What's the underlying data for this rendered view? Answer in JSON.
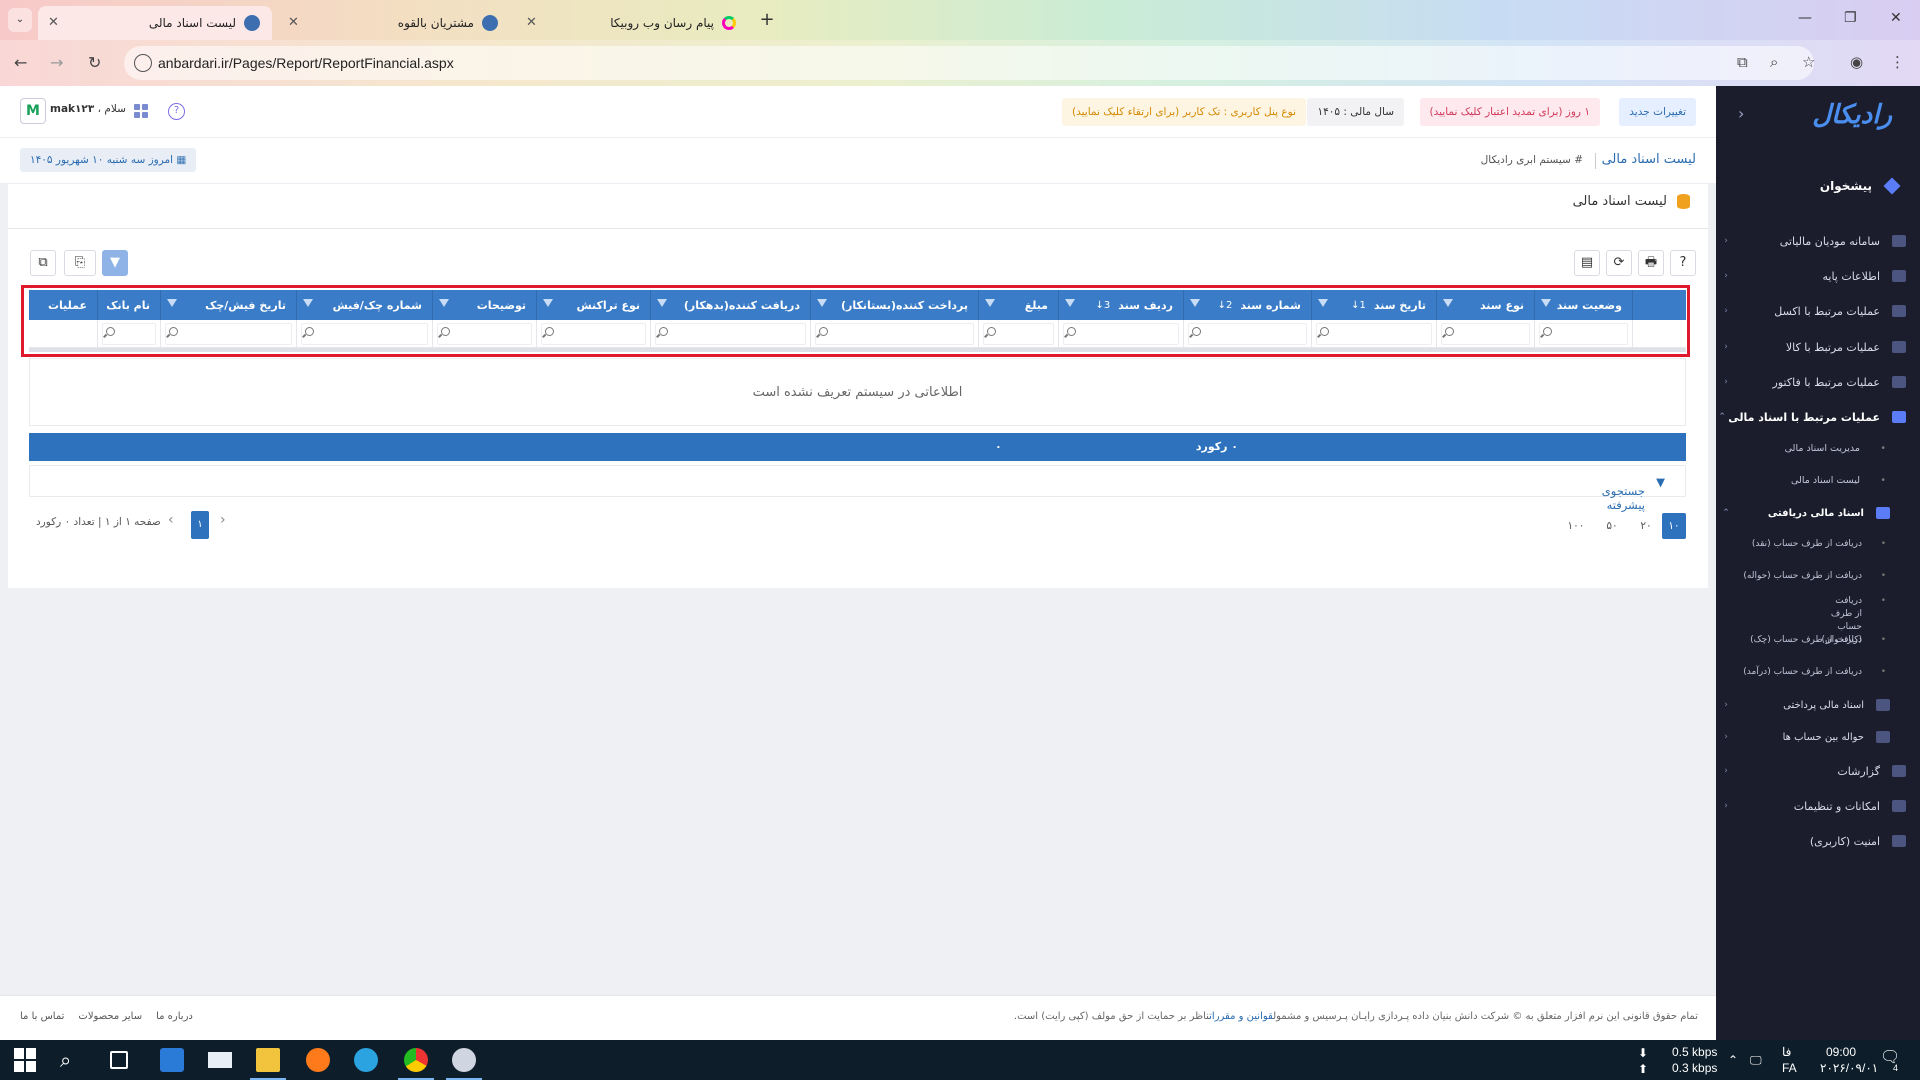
{
  "browser": {
    "tabs": [
      {
        "title": "لیست اسناد مالی",
        "active": true
      },
      {
        "title": "مشتریان بالقوه",
        "active": false
      },
      {
        "title": "پیام رسان وب روبیکا",
        "active": false
      }
    ],
    "new_tab": "+",
    "url": "anbardari.ir/Pages/Report/ReportFinancial.aspx"
  },
  "header": {
    "new_changes": "تغییرات جدید",
    "renew": "۱ روز (برای تمدید اعتبار کلیک نمایید)",
    "fiscal_year": "سال مالی : ۱۴۰۵",
    "panel_type": "نوع پنل کاربری : تک کاربر (برای ارتقاء کلیک نمایید)",
    "greeting_prefix": "سلام ،",
    "username": "mak۱۲۳",
    "avatar_letter": "M"
  },
  "breadcrumb": {
    "title": "لیست اسناد مالی",
    "system": "# سیستم ابری رادیکال",
    "today": "امروز سه شنبه ۱۰ شهریور ۱۴۰۵"
  },
  "panel": {
    "title": "لیست اسناد مالی",
    "toolbar": {
      "help": "?",
      "print": "🖶",
      "refresh": "⟳",
      "columns": "▤",
      "filter": "▼",
      "export": "⎘",
      "copy": "⧉"
    }
  },
  "grid": {
    "columns": [
      {
        "label": "",
        "sort": ""
      },
      {
        "label": "وضعیت سند",
        "sort": ""
      },
      {
        "label": "نوع سند",
        "sort": ""
      },
      {
        "label": "تاریخ سند",
        "sort": "1↓"
      },
      {
        "label": "شماره سند",
        "sort": "2↓"
      },
      {
        "label": "ردیف سند",
        "sort": "3↓"
      },
      {
        "label": "مبلغ",
        "sort": ""
      },
      {
        "label": "پرداخت کننده(بستانکار)",
        "sort": ""
      },
      {
        "label": "دریافت کننده(بدهکار)",
        "sort": ""
      },
      {
        "label": "نوع تراکنش",
        "sort": ""
      },
      {
        "label": "توضیحات",
        "sort": ""
      },
      {
        "label": "شماره چک/فیش",
        "sort": ""
      },
      {
        "label": "تاریخ فیش/چک",
        "sort": ""
      },
      {
        "label": "نام بانک",
        "sort": ""
      },
      {
        "label": "عملیات",
        "sort": ""
      }
    ],
    "empty_message": "اطلاعاتی در سیستم تعریف نشده است",
    "record_count": "۰ رکورد",
    "sum": "۰",
    "advanced_search": "جستجوی پیشرفته",
    "page_info": "صفحه ۱ از ۱ | تعداد ۰ رکورد",
    "current_page": "۱",
    "page_sizes": [
      "۱۰",
      "۲۰",
      "۵۰",
      "۱۰۰"
    ]
  },
  "sidebar": {
    "logo": "رادیکال",
    "dashboard": "پیشخوان",
    "items": [
      {
        "label": "سامانه مودیان مالیاتی",
        "arrow": "‹"
      },
      {
        "label": "اطلاعات پایه",
        "arrow": "‹"
      },
      {
        "label": "عملیات مرتبط با اکسل",
        "arrow": "‹"
      },
      {
        "label": "عملیات مرتبط با کالا",
        "arrow": "‹"
      },
      {
        "label": "عملیات مرتبط با فاکتور",
        "arrow": "‹"
      },
      {
        "label": "عملیات مرتبط با اسناد مالی",
        "arrow": "⌃"
      }
    ],
    "financial_subs": [
      "مدیریت اسناد مالی",
      "لیست اسناد مالی"
    ],
    "received": "اسناد مالی دریافتی",
    "received_subs": [
      "دریافت از طرف حساب (نقد)",
      "دریافت از طرف حساب (حواله)",
      "دریافت از طرف حساب (کارتخوان)",
      "دریافت از طرف حساب (چک)",
      "دریافت از طرف حساب (درآمد)"
    ],
    "tail_items": [
      {
        "label": "اسناد مالی پرداختی",
        "arrow": "‹"
      },
      {
        "label": "حواله بین حساب ها",
        "arrow": "‹"
      },
      {
        "label": "گزارشات",
        "arrow": "‹"
      },
      {
        "label": "امکانات و تنظیمات",
        "arrow": "‹"
      },
      {
        "label": "امنیت (کاربری)",
        "arrow": ""
      }
    ]
  },
  "footer": {
    "copyright_a": "تمام حقوق قانونی این نرم افزار متعلق به  ©  شرکت دانش بنیان داده پـردازی رایـان پـرسیس  و مشمول",
    "rules_link": "قوانین و مقررات",
    "copyright_b": "ناظر بر حمایت از حق مولف (کپی رایت) است.",
    "links": [
      "درباره ما",
      "سایر محصولات",
      "تماس با ما"
    ]
  },
  "taskbar": {
    "net_down": "0.5 kbps",
    "net_up": "0.3 kbps",
    "lang_top": "فا",
    "lang_bottom": "FA",
    "time": "09:00",
    "date": "۲۰۲۶/۰۹/۰۱",
    "notif_count": "4"
  }
}
